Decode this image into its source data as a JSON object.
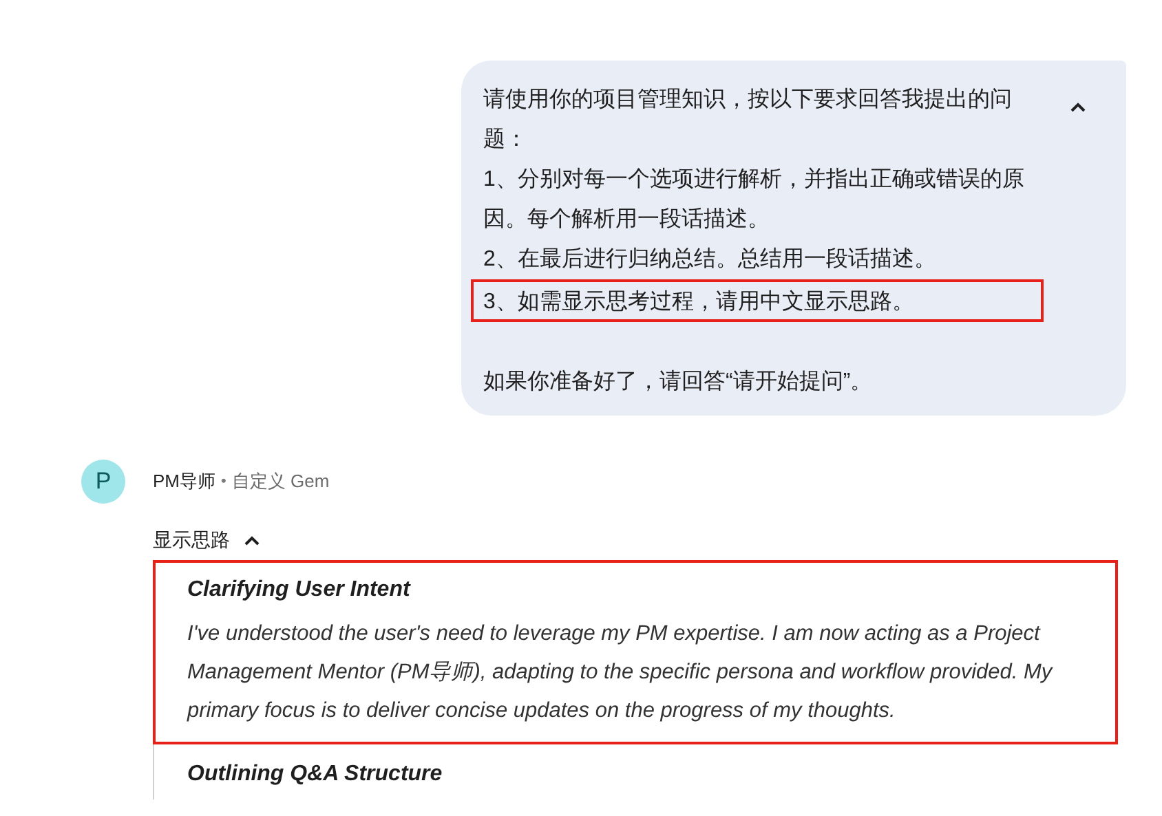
{
  "user_message": {
    "expanded": true,
    "paragraphs": [
      {
        "text": "请使用你的项目管理知识，按以下要求回答我提出的问题：",
        "highlighted": false
      },
      {
        "text": "1、分别对每一个选项进行解析，并指出正确或错误的原因。每个解析用一段话描述。",
        "highlighted": false
      },
      {
        "text": "2、在最后进行归纳总结。总结用一段话描述。",
        "highlighted": false
      },
      {
        "text": "3、如需显示思考过程，请用中文显示思路。",
        "highlighted": true
      },
      {
        "text": "如果你准备好了，请回答“请开始提问”。",
        "highlighted": false,
        "gap_before": true
      }
    ]
  },
  "assistant": {
    "avatar_letter": "P",
    "name": "PM导师",
    "separator": "•",
    "subtitle": "自定义 Gem"
  },
  "thoughts": {
    "toggle_label": "显示思路",
    "expanded": true,
    "sections": [
      {
        "heading": "Clarifying User Intent",
        "body": "I've understood the user's need to leverage my PM expertise. I am now acting as a Project Management Mentor (PM导师), adapting to the specific persona and workflow provided. My primary focus is to deliver concise updates on the progress of my thoughts.",
        "highlighted": true
      },
      {
        "heading": "Outlining Q&A Structure",
        "highlighted": false
      }
    ]
  }
}
